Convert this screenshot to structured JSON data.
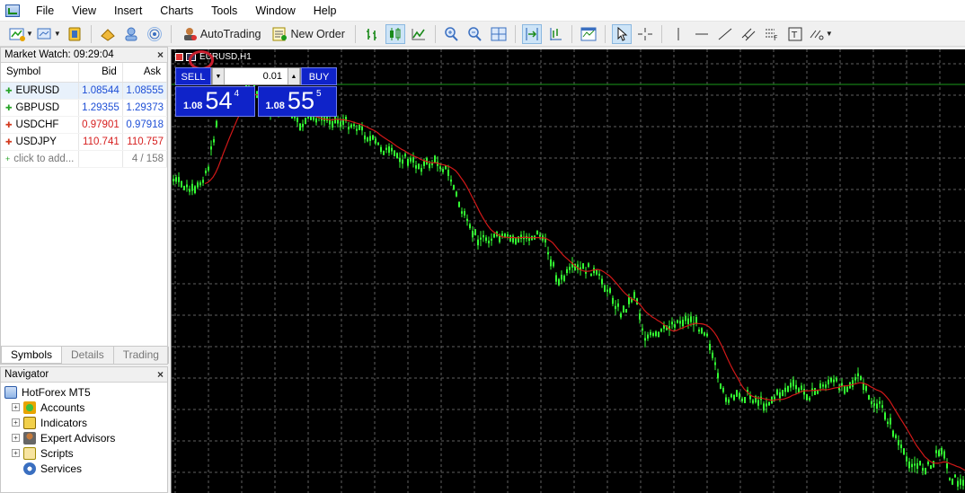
{
  "menu": {
    "items": [
      "File",
      "View",
      "Insert",
      "Charts",
      "Tools",
      "Window",
      "Help"
    ]
  },
  "toolbar": {
    "autotrading_label": "AutoTrading",
    "new_order_label": "New Order"
  },
  "market_watch": {
    "title": "Market Watch: 09:29:04",
    "columns": [
      "Symbol",
      "Bid",
      "Ask"
    ],
    "rows": [
      {
        "symbol": "EURUSD",
        "bid": "1.08544",
        "ask": "1.08555",
        "dir": "up"
      },
      {
        "symbol": "GBPUSD",
        "bid": "1.29355",
        "ask": "1.29373",
        "dir": "up"
      },
      {
        "symbol": "USDCHF",
        "bid": "0.97901",
        "ask": "0.97918",
        "dir": "down"
      },
      {
        "symbol": "USDJPY",
        "bid": "110.741",
        "ask": "110.757",
        "dir": "down"
      }
    ],
    "add_label": "click to add...",
    "count": "4 / 158",
    "tabs": [
      "Symbols",
      "Details",
      "Trading"
    ]
  },
  "navigator": {
    "title": "Navigator",
    "root": "HotForex MT5",
    "items": [
      "Accounts",
      "Indicators",
      "Expert Advisors",
      "Scripts",
      "Services"
    ]
  },
  "chart": {
    "title": "EURUSD,H1",
    "colors": {
      "bars": "#33ff33",
      "ma": "#d01818",
      "grid": "#606060",
      "hline": "#1a9a1a"
    }
  },
  "one_click": {
    "sell_label": "SELL",
    "buy_label": "BUY",
    "volume": "0.01",
    "sell_prefix": "1.08",
    "sell_big": "54",
    "sell_sup": "4",
    "buy_prefix": "1.08",
    "buy_big": "55",
    "buy_sup": "5"
  }
}
